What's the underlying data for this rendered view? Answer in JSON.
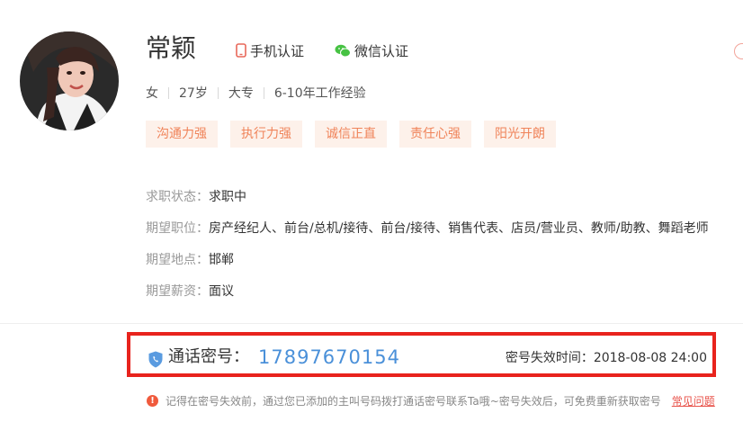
{
  "profile": {
    "name": "常颖",
    "phone_verified_label": "手机认证",
    "wechat_verified_label": "微信认证",
    "info": [
      "女",
      "27岁",
      "大专",
      "6-10年工作经验"
    ],
    "tags": [
      "沟通力强",
      "执行力强",
      "诚信正直",
      "责任心强",
      "阳光开朗"
    ]
  },
  "details": [
    {
      "label": "求职状态：",
      "value": "求职中"
    },
    {
      "label": "期望职位：",
      "value": "房产经纪人、前台/总机/接待、前台/接待、销售代表、店员/营业员、教师/助教、舞蹈老师"
    },
    {
      "label": "期望地点：",
      "value": "邯郸"
    },
    {
      "label": "期望薪资：",
      "value": "面议"
    }
  ],
  "call": {
    "label": "通话密号：",
    "number": "17897670154",
    "expire_label": "密号失效时间：",
    "expire_time": "2018-08-08 24:00"
  },
  "notice": {
    "text": "记得在密号失效前，通过您已添加的主叫号码拨打通话密号联系Ta哦~密号失效后，可免费重新获取密号",
    "faq_label": "常见问题"
  },
  "colors": {
    "tag_bg": "#fdf1ea",
    "tag_text": "#f0845a",
    "number": "#4a90d9",
    "highlight_border": "#e8231d",
    "warning": "#f05a3c"
  },
  "icons": {
    "phone_verified": "phone-icon",
    "wechat_verified": "wechat-icon",
    "call": "shield-phone-icon",
    "notice": "warning-icon"
  }
}
